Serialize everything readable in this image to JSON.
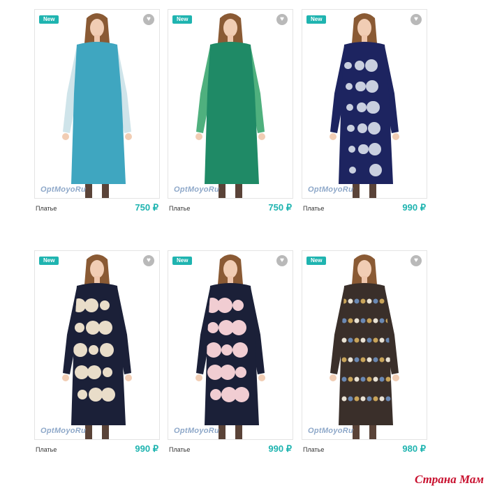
{
  "products": [
    {
      "badge": "New",
      "name": "Платье",
      "price": "750 ₽",
      "brand": "OptMoyoRu",
      "dress_color": "#3fa6c0",
      "sleeve_color": "#cfe4ea",
      "pattern": "plain"
    },
    {
      "badge": "New",
      "name": "Платье",
      "price": "750 ₽",
      "brand": "OptMoyoRu",
      "dress_color": "#1f8a66",
      "sleeve_color": "#4fb07e",
      "pattern": "plain"
    },
    {
      "badge": "New",
      "name": "Платье",
      "price": "990 ₽",
      "brand": "OptMoyoRu",
      "dress_color": "#1d2460",
      "sleeve_color": "#1d2460",
      "pattern": "paisley"
    },
    {
      "badge": "New",
      "name": "Платье",
      "price": "990 ₽",
      "brand": "OptMoyoRu",
      "dress_color": "#1b2038",
      "sleeve_color": "#1b2038",
      "pattern": "floral-cream"
    },
    {
      "badge": "New",
      "name": "Платье",
      "price": "990 ₽",
      "brand": "OptMoyoRu",
      "dress_color": "#1b2038",
      "sleeve_color": "#1b2038",
      "pattern": "floral-pink"
    },
    {
      "badge": "New",
      "name": "Платье",
      "price": "980 ₽",
      "brand": "OptMoyoRu",
      "dress_color": "#3a2f2a",
      "sleeve_color": "#3a2f2a",
      "pattern": "dots"
    }
  ],
  "favorite_icon": "heart-icon",
  "watermark": "Страна Мам",
  "colors": {
    "accent": "#1fb4b0",
    "watermark": "#c8102e"
  }
}
